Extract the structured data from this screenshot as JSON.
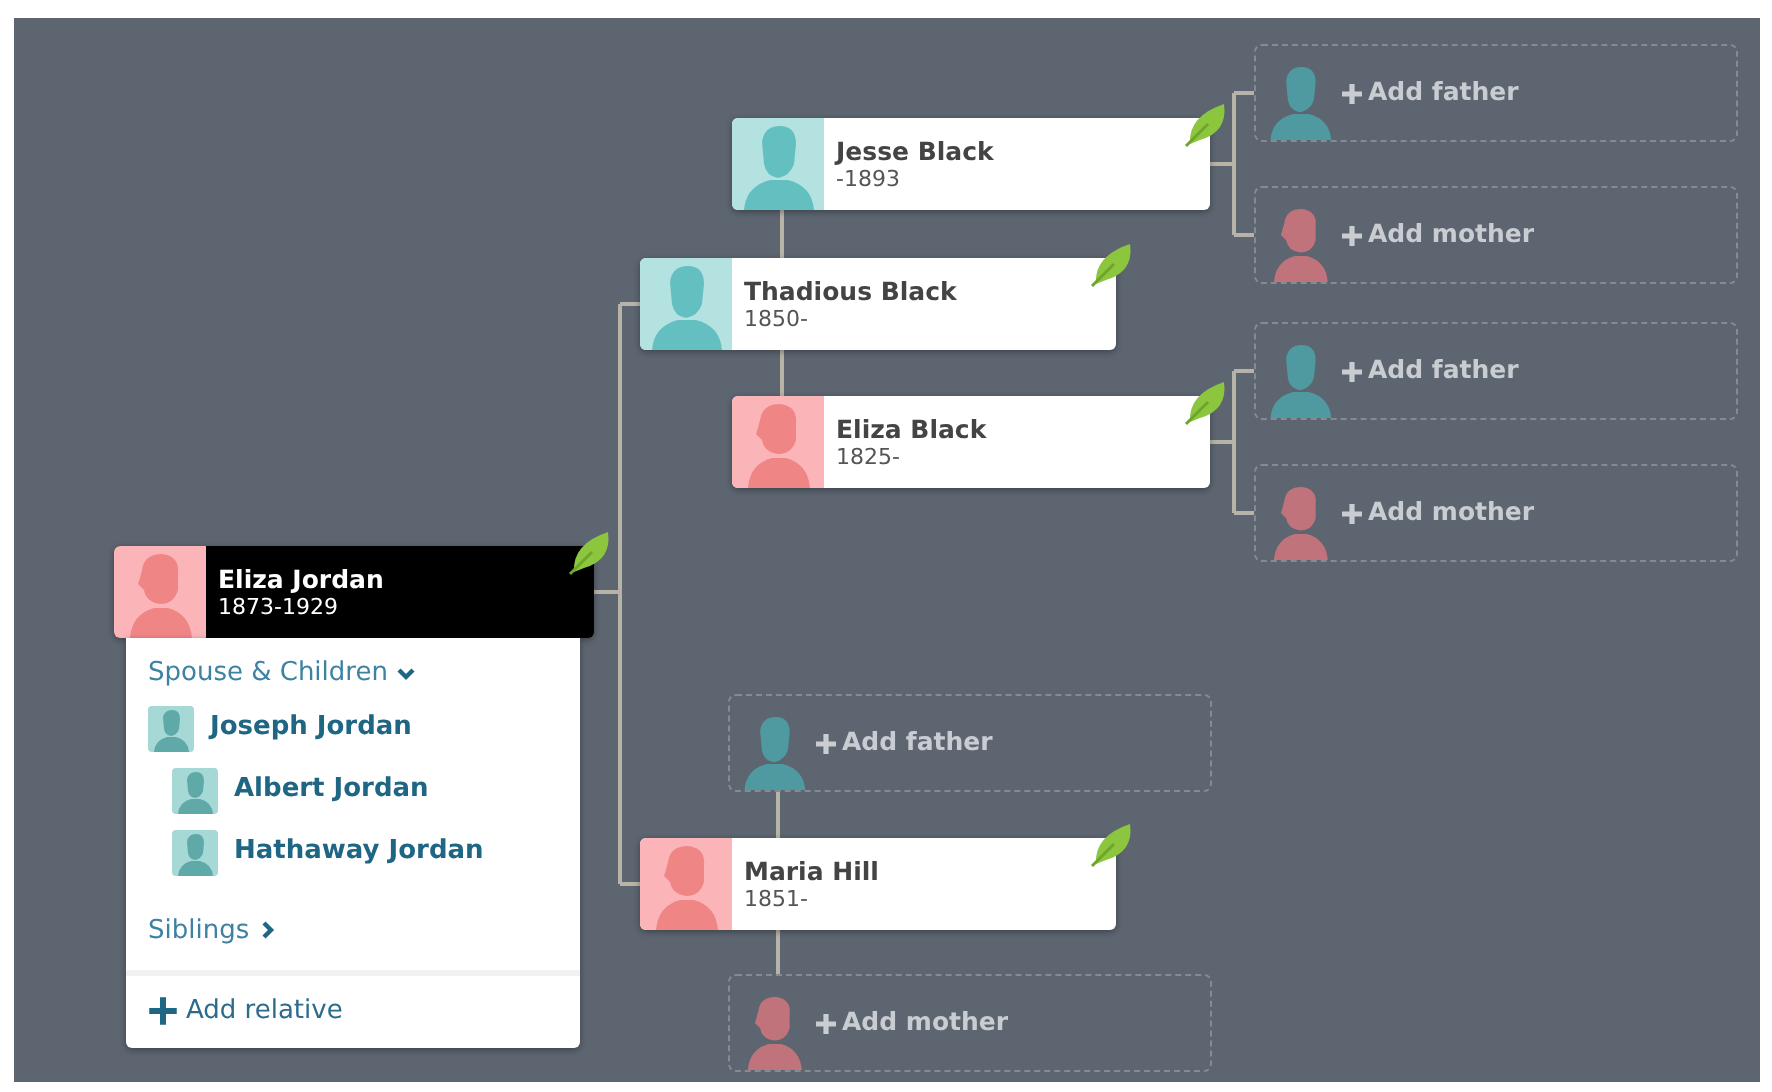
{
  "tree": {
    "kind": "person",
    "name": "Eliza Jordan",
    "dates": "1873-1929",
    "female": true,
    "selected": true,
    "hint": true,
    "panel": {
      "sections": [
        {
          "title": "Spouse & Children",
          "expanded": true,
          "members": [
            {
              "name": "Joseph Jordan",
              "children": [
                {
                  "name": "Albert Jordan"
                },
                {
                  "name": "Hathaway Jordan"
                }
              ]
            }
          ]
        },
        {
          "title": "Siblings",
          "expanded": false
        }
      ],
      "action": "Add relative"
    },
    "parents": [
      {
        "kind": "person",
        "name": "Thadious Black",
        "dates": "1850-",
        "female": false,
        "selected": false,
        "hint": true,
        "parents": [
          {
            "kind": "person",
            "name": "Jesse Black",
            "dates": "-1893",
            "female": false,
            "selected": false,
            "hint": true,
            "parents": [
              {
                "kind": "placeholder",
                "label": "Add father",
                "female": false
              },
              {
                "kind": "placeholder",
                "label": "Add mother",
                "female": true
              }
            ]
          },
          {
            "kind": "person",
            "name": "Eliza Black",
            "dates": "1825-",
            "female": true,
            "selected": false,
            "hint": true,
            "parents": [
              {
                "kind": "placeholder",
                "label": "Add father",
                "female": false
              },
              {
                "kind": "placeholder",
                "label": "Add mother",
                "female": true
              }
            ]
          }
        ]
      },
      {
        "kind": "person",
        "name": "Maria Hill",
        "dates": "1851-",
        "female": true,
        "selected": false,
        "hint": true,
        "parents": [
          {
            "kind": "placeholder",
            "label": "Add father",
            "female": false
          },
          {
            "kind": "placeholder",
            "label": "Add mother",
            "female": true
          }
        ]
      }
    ]
  }
}
